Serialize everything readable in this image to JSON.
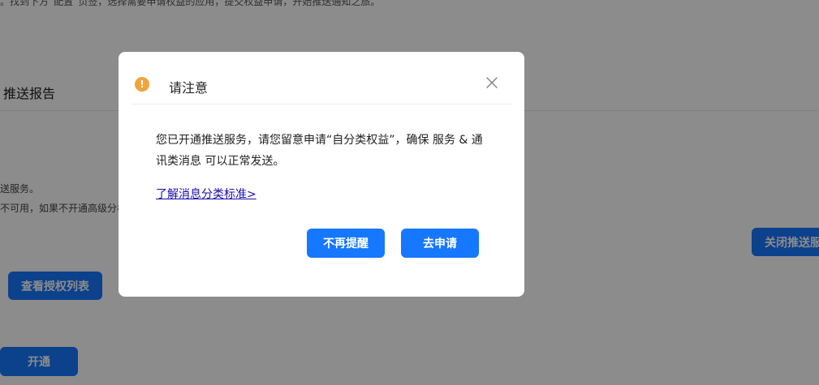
{
  "background": {
    "hint_text": "。找到下方“配置”页签，选择需要申请权益的应用，提交权益申请，开始推送通知之旅。",
    "section_title": "推送报告",
    "desc_line1": "送服务。",
    "desc_line2": "不可用，如果不开通高级分析",
    "view_auth_list_label": "查看授权列表",
    "open_label": "开通",
    "close_push_label": "关闭推送服务"
  },
  "modal": {
    "title": "请注意",
    "body": "您已开通推送服务，请您留意申请“自分类权益”，确保 服务 & 通讯类消息 可以正常发送。",
    "learn_link": "了解消息分类标准>",
    "no_remind_label": "不再提醒",
    "apply_label": "去申请",
    "icons": {
      "warning": "warning-circle-icon",
      "close": "close-icon"
    },
    "colors": {
      "primary": "#1677ff",
      "warning": "#f0a43a",
      "link": "#1a0dab"
    }
  }
}
